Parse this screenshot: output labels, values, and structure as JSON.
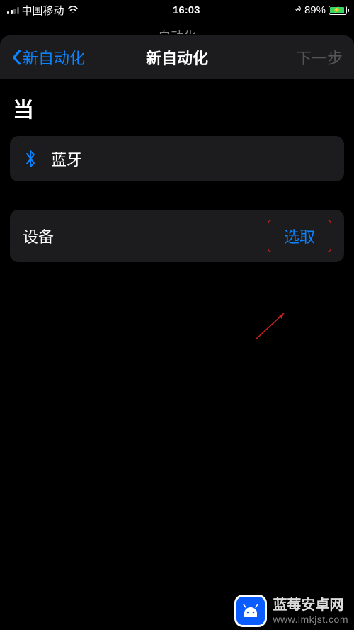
{
  "status_bar": {
    "carrier": "中国移动",
    "time": "16:03",
    "battery_percent": "89%"
  },
  "peek": {
    "title": "自动化"
  },
  "nav": {
    "back_label": "新自动化",
    "title": "新自动化",
    "next_label": "下一步"
  },
  "content": {
    "when_heading": "当",
    "bluetooth_label": "蓝牙",
    "device_label": "设备",
    "select_label": "选取"
  },
  "watermark": {
    "title": "蓝莓安卓网",
    "url": "www.lmkjst.com"
  }
}
